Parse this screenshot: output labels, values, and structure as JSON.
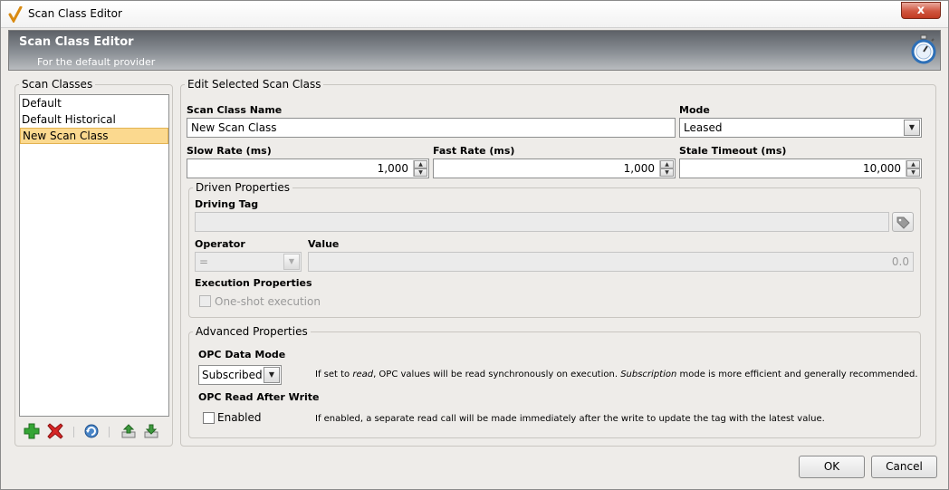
{
  "window": {
    "title": "Scan Class Editor",
    "close_label": "x"
  },
  "banner": {
    "title": "Scan Class Editor",
    "subtitle": "For the default provider"
  },
  "scan_classes": {
    "legend": "Scan Classes",
    "items": [
      {
        "label": "Default",
        "selected": false
      },
      {
        "label": "Default Historical",
        "selected": false
      },
      {
        "label": "New Scan Class",
        "selected": true
      }
    ]
  },
  "edit": {
    "legend": "Edit Selected Scan Class",
    "name_label": "Scan Class Name",
    "name_value": "New Scan Class",
    "mode_label": "Mode",
    "mode_value": "Leased",
    "slow_label": "Slow Rate (ms)",
    "slow_value": "1,000",
    "fast_label": "Fast Rate (ms)",
    "fast_value": "1,000",
    "stale_label": "Stale Timeout (ms)",
    "stale_value": "10,000"
  },
  "driven": {
    "legend": "Driven Properties",
    "driving_tag_label": "Driving Tag",
    "driving_tag_value": "",
    "operator_label": "Operator",
    "operator_value": "=",
    "value_label": "Value",
    "value_value": "0.0",
    "execution_label": "Execution Properties",
    "oneshot_label": "One-shot execution",
    "oneshot_checked": false
  },
  "advanced": {
    "legend": "Advanced Properties",
    "opc_mode_label": "OPC Data Mode",
    "opc_mode_value": "Subscribed",
    "opc_mode_help_1": "If set to ",
    "opc_mode_help_read": "read",
    "opc_mode_help_2": ", OPC values will be read synchronously on execution. ",
    "opc_mode_help_sub": "Subscription",
    "opc_mode_help_3": " mode is more efficient and generally recommended.",
    "read_after_label": "OPC Read After Write",
    "enabled_label": "Enabled",
    "enabled_checked": false,
    "read_after_help": "If enabled, a separate read call will be made immediately after the write to update the tag with the latest value."
  },
  "footer": {
    "ok_label": "OK",
    "cancel_label": "Cancel"
  },
  "colors": {
    "selection": "#fbd98f",
    "banner": "#6f7379",
    "add": "#2e9b2e",
    "delete": "#d32020"
  }
}
